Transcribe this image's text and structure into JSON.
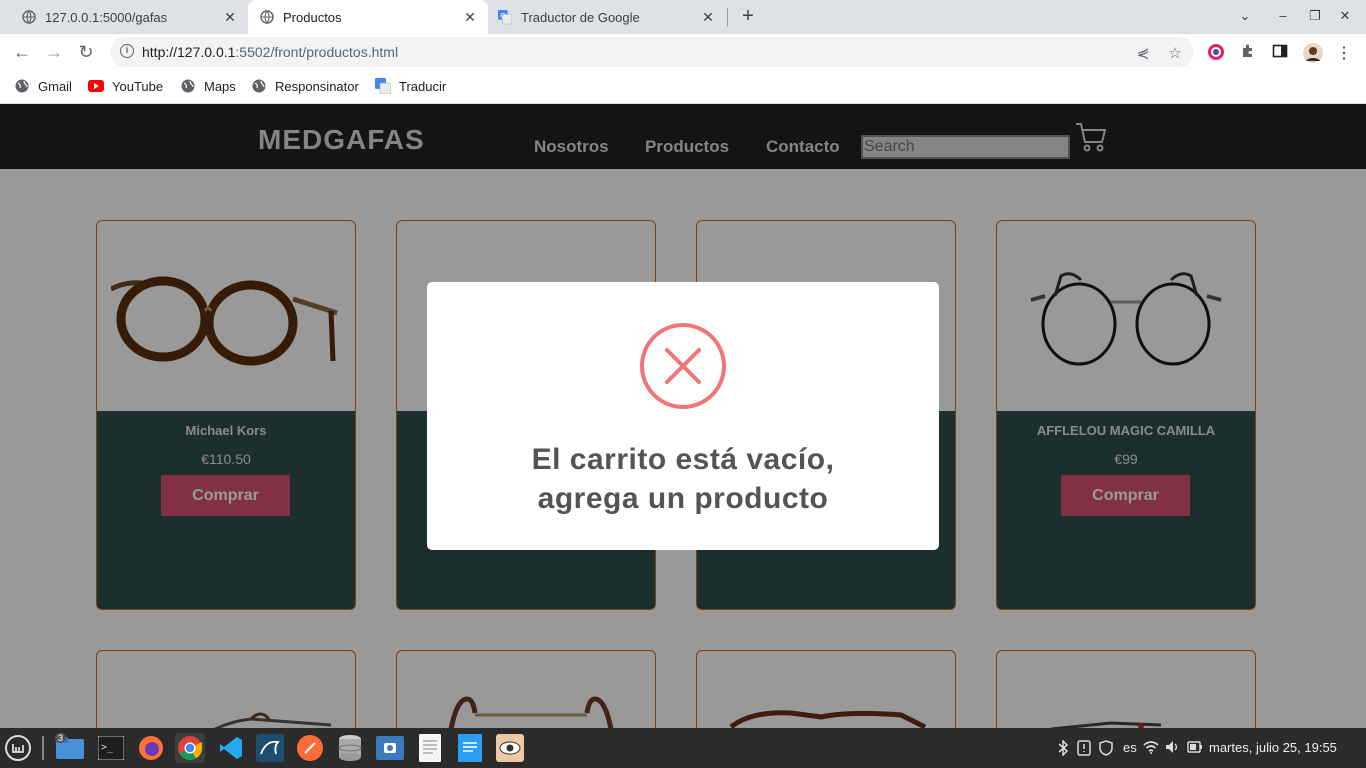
{
  "browser": {
    "tabs": [
      {
        "title": "127.0.0.1:5000/gafas"
      },
      {
        "title": "Productos"
      },
      {
        "title": "Traductor de Google"
      }
    ],
    "url_host": "http://127.0.0.1",
    "url_rest": ":5502/front/productos.html",
    "bookmarks": [
      "Gmail",
      "YouTube",
      "Maps",
      "Responsinator",
      "Traducir"
    ]
  },
  "site": {
    "logo": "MEDGAFAS",
    "nav": [
      "Nosotros",
      "Productos",
      "Contacto"
    ],
    "search_placeholder": "Search"
  },
  "products": [
    {
      "name": "Michael Kors",
      "price": "€110.50",
      "buy": "Comprar"
    },
    {
      "name": "AFFLELOU MAGIC CAMILLA",
      "price": "€99",
      "buy": "Comprar"
    }
  ],
  "modal": {
    "line1": "El carrito está vacío,",
    "line2": "agrega un producto"
  },
  "taskbar": {
    "files_badge": "3",
    "lang": "es",
    "clock": "martes, julio 25, 19:55"
  }
}
